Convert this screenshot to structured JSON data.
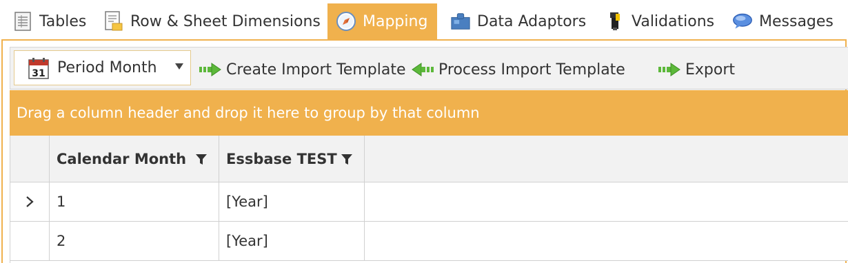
{
  "tabs": [
    {
      "label": "Tables",
      "icon": "table-icon"
    },
    {
      "label": "Row & Sheet Dimensions",
      "icon": "sheet-dimensions-icon"
    },
    {
      "label": "Mapping",
      "icon": "compass-icon",
      "active": true
    },
    {
      "label": "Data Adaptors",
      "icon": "puzzle-icon"
    },
    {
      "label": "Validations",
      "icon": "validation-icon"
    },
    {
      "label": "Messages",
      "icon": "speech-bubble-icon"
    }
  ],
  "toolbar": {
    "dropdown_value": "Period Month",
    "dropdown_icon_day": "31",
    "create_label": "Create Import Template",
    "process_label": "Process Import Template",
    "export_label": "Export"
  },
  "group_panel": {
    "text": "Drag a column header and drop it here to group by that column"
  },
  "grid": {
    "columns": [
      "Calendar Month",
      "Essbase TEST"
    ],
    "rows": [
      {
        "calendar_month": "1",
        "essbase_test": "[Year]",
        "expanded_indicator": true
      },
      {
        "calendar_month": "2",
        "essbase_test": "[Year]",
        "expanded_indicator": false
      }
    ]
  },
  "colors": {
    "accent": "#f0b14d",
    "toolbar_bg": "#f2f2f2",
    "grid_line": "#d0d0d0",
    "arrow_green": "#5cb83a"
  }
}
